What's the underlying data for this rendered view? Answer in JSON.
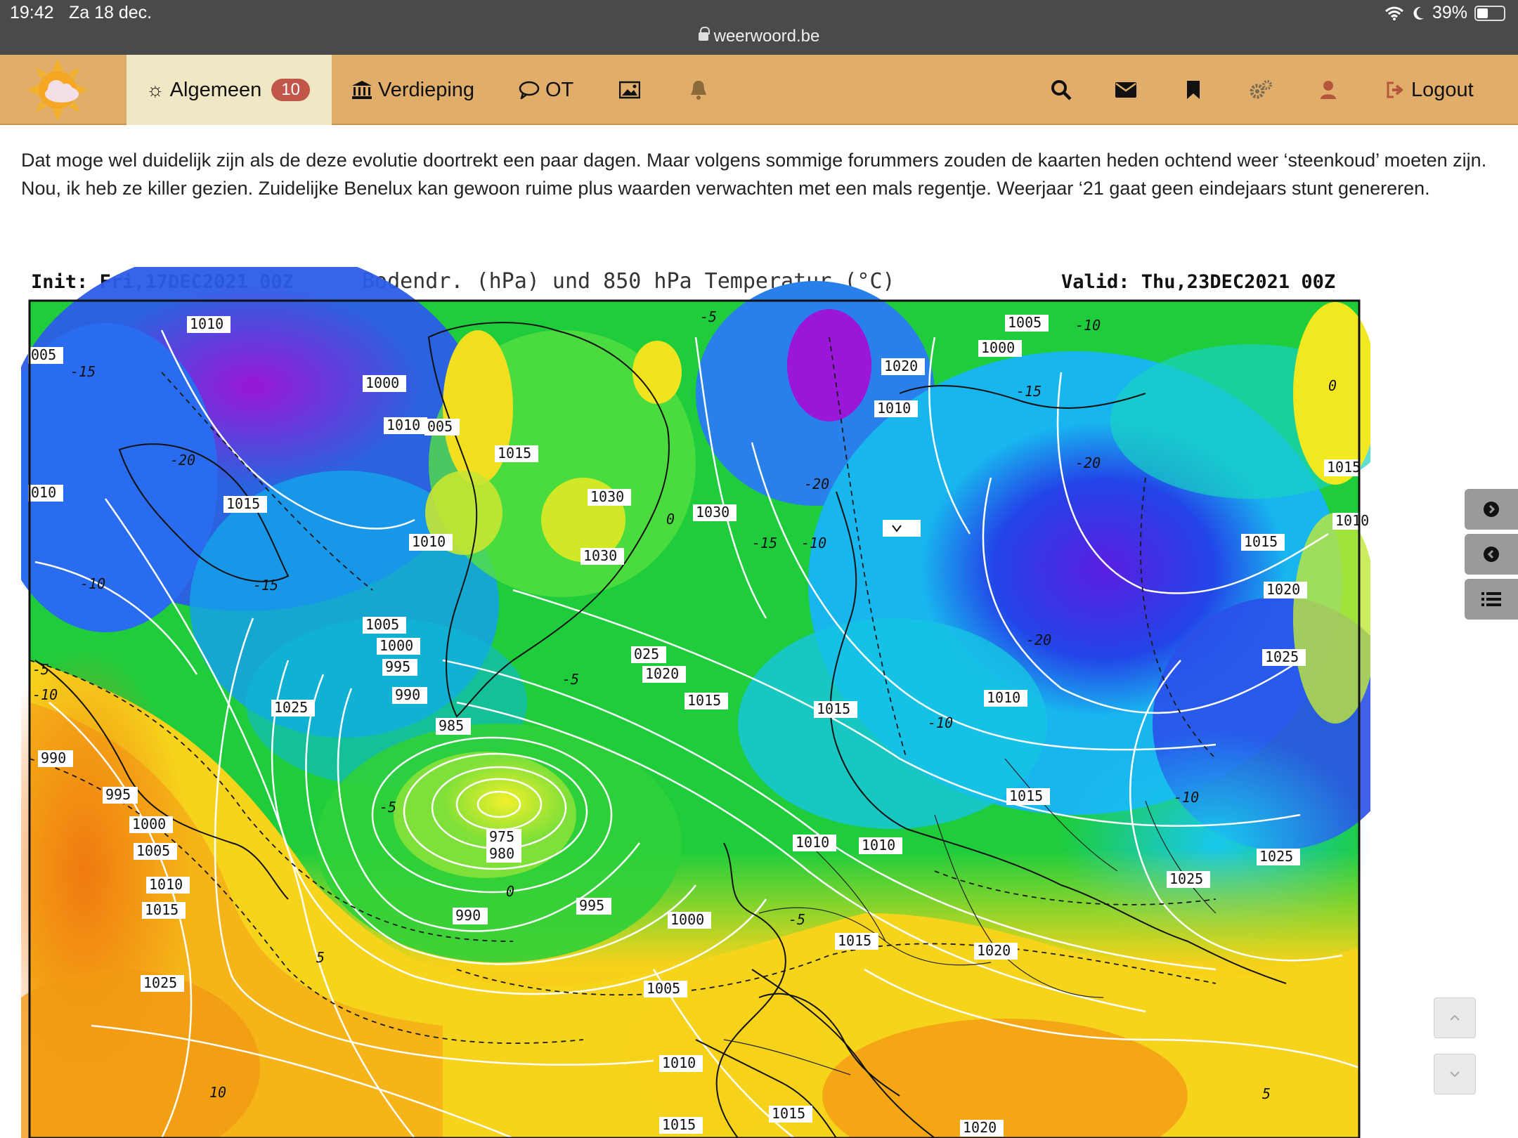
{
  "status": {
    "time": "19:42",
    "date": "Za 18 dec.",
    "url": "weerwoord.be",
    "battery": "39%"
  },
  "nav": {
    "algemeen": "Algemeen",
    "algemeen_badge": "10",
    "verdieping": "Verdieping",
    "ot": "OT",
    "logout": "Logout"
  },
  "post": {
    "text": "Dat moge wel duidelijk zijn als de deze evolutie doortrekt een paar dagen. Maar volgens sommige forummers zouden de kaarten heden ochtend weer ‘steenkoud’ moeten zijn. Nou, ik heb ze killer gezien. Zuidelijke Benelux kan gewoon ruime plus waarden verwachten met een mals regentje. Weerjaar ‘21 gaat geen eindejaars stunt genereren."
  },
  "map": {
    "init": "Init: Fri,17DEC2021 00Z",
    "title": "Bodendr. (hPa) und 850 hPa Temperatur (°C)",
    "valid": "Valid: Thu,23DEC2021 00Z",
    "isobar_labels": [
      "1010",
      "005",
      "1000",
      "1010",
      "005",
      "1015",
      "1015",
      "010",
      "1010",
      "1005",
      "1000",
      "995",
      "990",
      "985",
      "975",
      "980",
      "990",
      "995",
      "1000",
      "1005",
      "1010",
      "1015",
      "1025",
      "990",
      "995",
      "1000",
      "1005",
      "1010",
      "1015",
      "1025",
      "1030",
      "1030",
      "1030",
      "025",
      "1020",
      "1015",
      "1015",
      "1010",
      "1015",
      "1010",
      "1005",
      "1000",
      "1020",
      "1010",
      "1015",
      "1010",
      "1015",
      "1020",
      "1025",
      "1025",
      "1025",
      "1010",
      "1015",
      "1020",
      "1015",
      "1020"
    ],
    "temp_labels": [
      "-15",
      "-20",
      "-15",
      "-10",
      "-5",
      "-10",
      "-5",
      "0",
      "-5",
      "0",
      "-5",
      "-10",
      "-15",
      "-20",
      "-10",
      "-20",
      "-10",
      "-15",
      "-20",
      "-10",
      "-5",
      "0",
      "5",
      "10",
      "5"
    ]
  },
  "colors": {
    "navbar": "#e0ae6a",
    "active_tab": "#f0e7c4",
    "badge": "#c0574a",
    "statusbar": "#4a4a4a"
  }
}
